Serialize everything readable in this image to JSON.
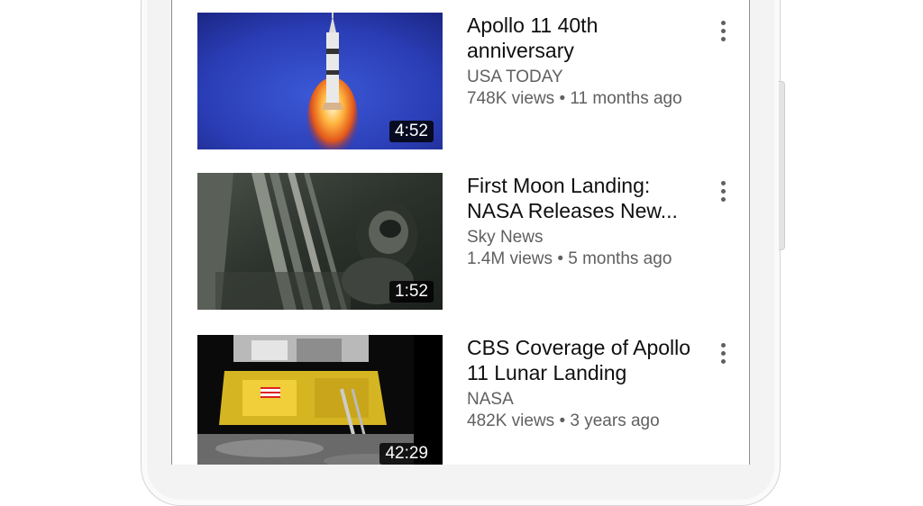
{
  "videos": [
    {
      "title_line1": "Apollo 11 40th",
      "title_line2": "anniversary",
      "channel": "USA TODAY",
      "views": "748K views",
      "separator": "•",
      "age": "11 months ago",
      "duration": "4:52"
    },
    {
      "title_line1": "First Moon Landing:",
      "title_line2": "NASA Releases New...",
      "channel": "Sky News",
      "views": "1.4M views",
      "separator": "•",
      "age": "5 months ago",
      "duration": "1:52"
    },
    {
      "title_line1": "CBS Coverage of Apollo",
      "title_line2": "11 Lunar Landing",
      "channel": "NASA",
      "views": "482K views",
      "separator": "•",
      "age": "3 years ago",
      "duration": "42:29"
    }
  ],
  "icons": {
    "menu": "more-vert-icon"
  }
}
